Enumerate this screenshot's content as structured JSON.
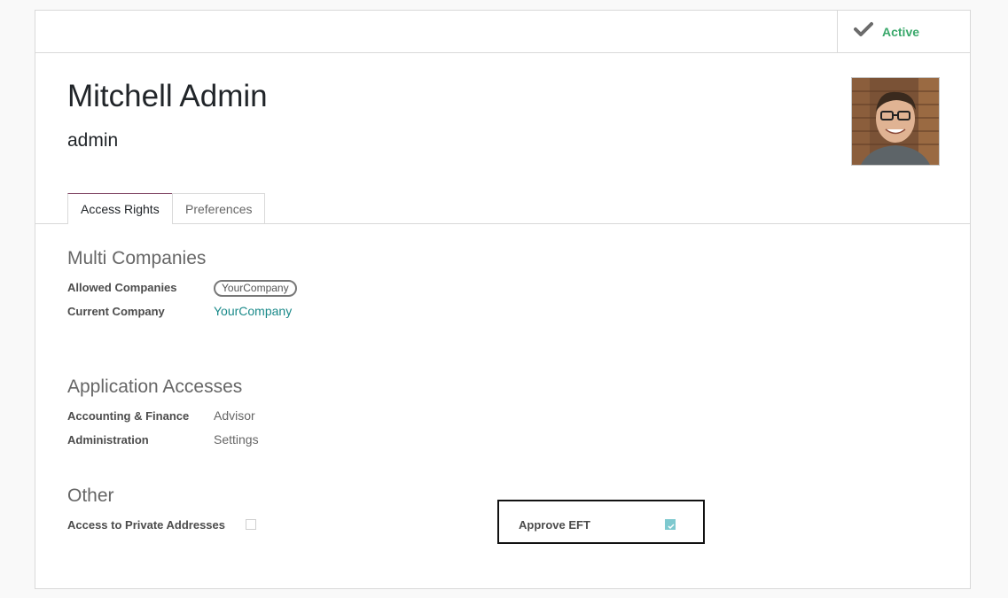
{
  "status": {
    "active_label": "Active",
    "icon": "check-icon"
  },
  "user": {
    "name": "Mitchell Admin",
    "login": "admin",
    "avatar": "user-photo"
  },
  "tabs": [
    {
      "label": "Access Rights",
      "active": true
    },
    {
      "label": "Preferences",
      "active": false
    }
  ],
  "multi_companies": {
    "title": "Multi Companies",
    "allowed_label": "Allowed Companies",
    "allowed_tag": "YourCompany",
    "current_label": "Current Company",
    "current_value": "YourCompany"
  },
  "app_access": {
    "title": "Application Accesses",
    "rows": [
      {
        "label": "Accounting & Finance",
        "value": "Advisor"
      },
      {
        "label": "Administration",
        "value": "Settings"
      }
    ]
  },
  "other": {
    "title": "Other",
    "private_label": "Access to Private Addresses",
    "private_checked": false,
    "eft_label": "Approve EFT",
    "eft_checked": true
  },
  "colors": {
    "accent": "#7c3f5e",
    "active_green": "#3aa86b",
    "link_teal": "#1a8a8a",
    "check_fill": "#7ec9cf"
  }
}
